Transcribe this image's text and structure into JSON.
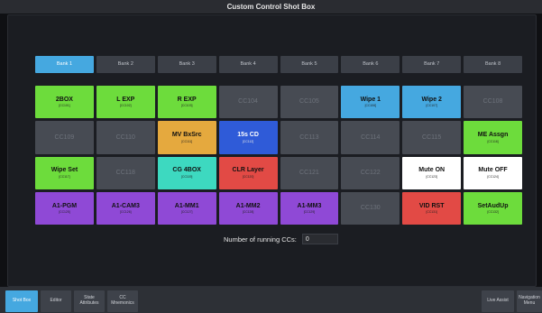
{
  "window": {
    "title": "Custom Control Shot Box"
  },
  "banks": [
    "Bank 1",
    "Bank 2",
    "Bank 3",
    "Bank 4",
    "Bank 5",
    "Bank 6",
    "Bank 7",
    "Bank 8"
  ],
  "active_bank": 0,
  "cells": [
    {
      "label": "2BOX",
      "sub": "[CC101]",
      "color": "#6ddc3c"
    },
    {
      "label": "L EXP",
      "sub": "[CC102]",
      "color": "#6ddc3c"
    },
    {
      "label": "R EXP",
      "sub": "[CC103]",
      "color": "#6ddc3c"
    },
    {
      "label": "CC104",
      "sub": "",
      "color": "#474b53",
      "empty": true
    },
    {
      "label": "CC105",
      "sub": "",
      "color": "#474b53",
      "empty": true
    },
    {
      "label": "Wipe 1",
      "sub": "[CC106]",
      "color": "#45a8e0"
    },
    {
      "label": "Wipe 2",
      "sub": "[CC107]",
      "color": "#45a8e0"
    },
    {
      "label": "CC108",
      "sub": "",
      "color": "#474b53",
      "empty": true
    },
    {
      "label": "CC109",
      "sub": "",
      "color": "#474b53",
      "empty": true
    },
    {
      "label": "CC110",
      "sub": "",
      "color": "#474b53",
      "empty": true
    },
    {
      "label": "MV BxSrc",
      "sub": "[CC111]",
      "color": "#e5a93e"
    },
    {
      "label": "15s CD",
      "sub": "[CC112]",
      "color": "#2f5bd8",
      "dark": true
    },
    {
      "label": "CC113",
      "sub": "",
      "color": "#474b53",
      "empty": true
    },
    {
      "label": "CC114",
      "sub": "",
      "color": "#474b53",
      "empty": true
    },
    {
      "label": "CC115",
      "sub": "",
      "color": "#474b53",
      "empty": true
    },
    {
      "label": "ME Assgn",
      "sub": "[CC116]",
      "color": "#6ddc3c"
    },
    {
      "label": "Wipe Set",
      "sub": "[CC117]",
      "color": "#6ddc3c"
    },
    {
      "label": "CC118",
      "sub": "",
      "color": "#474b53",
      "empty": true
    },
    {
      "label": "CG 4BOX",
      "sub": "[CC119]",
      "color": "#3dd9c0"
    },
    {
      "label": "CLR Layer",
      "sub": "[CC120]",
      "color": "#e24a45"
    },
    {
      "label": "CC121",
      "sub": "",
      "color": "#474b53",
      "empty": true
    },
    {
      "label": "CC122",
      "sub": "",
      "color": "#474b53",
      "empty": true
    },
    {
      "label": "Mute ON",
      "sub": "[CC123]",
      "color": "#ffffff"
    },
    {
      "label": "Mute OFF",
      "sub": "[CC124]",
      "color": "#ffffff"
    },
    {
      "label": "A1-PGM",
      "sub": "[CC125]",
      "color": "#8f49d6"
    },
    {
      "label": "A1-CAM3",
      "sub": "[CC126]",
      "color": "#8f49d6"
    },
    {
      "label": "A1-MM1",
      "sub": "[CC127]",
      "color": "#8f49d6"
    },
    {
      "label": "A1-MM2",
      "sub": "[CC128]",
      "color": "#8f49d6"
    },
    {
      "label": "A1-MM3",
      "sub": "[CC129]",
      "color": "#8f49d6"
    },
    {
      "label": "CC130",
      "sub": "",
      "color": "#474b53",
      "empty": true
    },
    {
      "label": "VID RST",
      "sub": "[CC131]",
      "color": "#e24a45"
    },
    {
      "label": "SetAudUp",
      "sub": "[CC132]",
      "color": "#6ddc3c"
    }
  ],
  "running": {
    "label": "Number of running CCs:",
    "value": "0"
  },
  "bottom_tabs": [
    {
      "label": "Shot Box",
      "active": true
    },
    {
      "label": "Editor"
    },
    {
      "label": "State\nAttributes"
    },
    {
      "label": "CC\nMnemonics"
    },
    {
      "label": "Live Assist"
    },
    {
      "label": "Navigation\nMenu"
    }
  ]
}
